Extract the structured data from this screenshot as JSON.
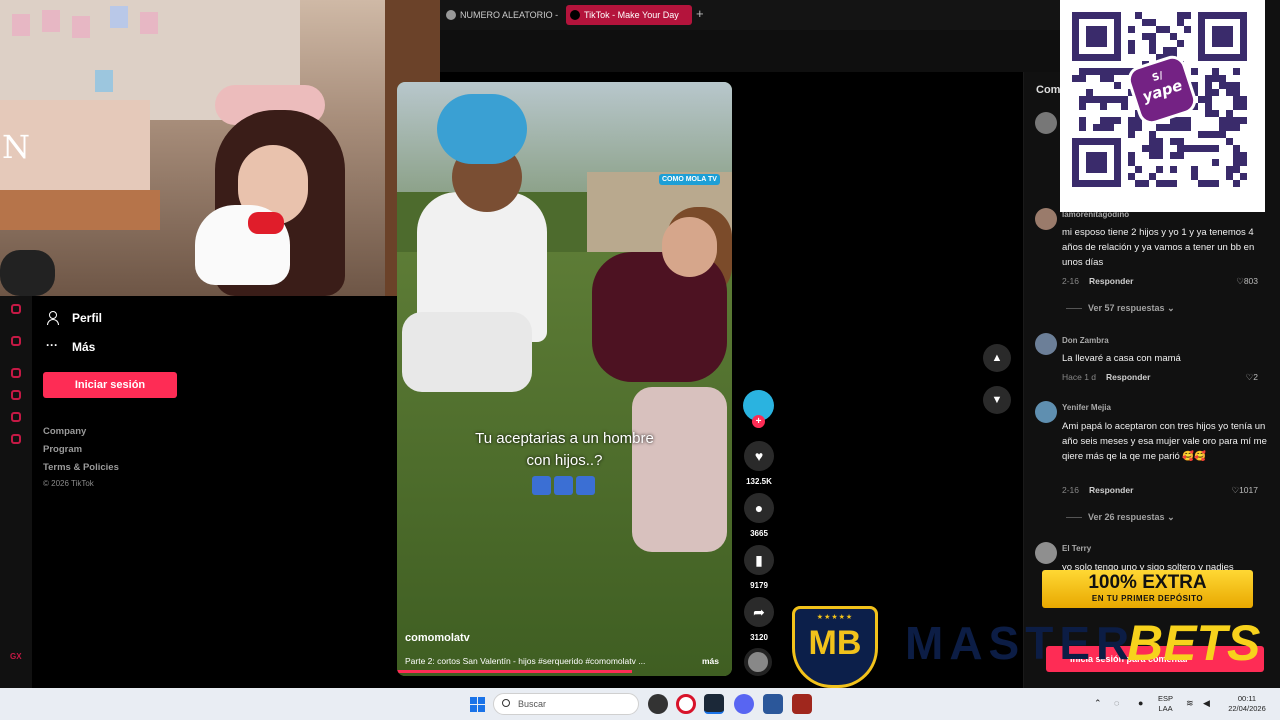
{
  "browser": {
    "tabs": [
      {
        "label": "NUMERO ALEATORIO - Bu",
        "active": false
      },
      {
        "label": "TikTok - Make Your Day",
        "active": true
      }
    ],
    "new_tab": "+"
  },
  "sidebar": {
    "profile_label": "Perfil",
    "more_label": "Más",
    "login_button": "Iniciar sesión",
    "footer_links": [
      "Company",
      "Program",
      "Terms & Policies"
    ],
    "copyright": "© 2026 TikTok",
    "rail_badge": "GX"
  },
  "stream_overlay": {
    "logo_letter": "N"
  },
  "video": {
    "caption_line1": "Tu aceptarias a un hombre",
    "caption_line2": "con hijos..?",
    "watermark": "COMO MOLA TV",
    "author": "comomolatv",
    "description": "Parte 2: cortos San Valentín - hijos #serquerido #comomolatv ...",
    "more_label": "más",
    "progress": 0.7
  },
  "actions": {
    "likes": "132.5K",
    "comments": "3665",
    "saves": "9179",
    "shares": "3120"
  },
  "comments": {
    "title": "Com",
    "items": [
      {
        "user": "lamorenitagodino",
        "text": "mi esposo tiene 2 hijos y yo 1 y ya tenemos 4 años de relación y ya vamos a tener un bb en unos días",
        "date": "2-16",
        "reply": "Responder",
        "likes": "803",
        "view_replies": "Ver 57 respuestas"
      },
      {
        "user": "Don Zambra",
        "text": "La llevaré a casa con mamá",
        "date": "Hace 1 d",
        "reply": "Responder",
        "likes": "2",
        "view_replies": ""
      },
      {
        "user": "Yenifer Mejia",
        "text": "Ami papá lo aceptaron con tres hijos yo tenía un año seis meses y esa mujer vale oro para mí me qiere más qe la qe me parió 🥰🥰",
        "date": "2-16",
        "reply": "Responder",
        "likes": "1017",
        "view_replies": "Ver 26 respuestas"
      },
      {
        "user": "El Terry",
        "text": "yo solo tengo uno y sigo soltero y nadies",
        "date": "",
        "reply": "",
        "likes": "",
        "view_replies": ""
      }
    ],
    "add_comment": "Inicia sesión para comentar"
  },
  "qr_overlay": {
    "currency": "S/",
    "brand": "yape"
  },
  "ad_overlay": {
    "headline": "100% EXTRA",
    "subline": "EN TU PRIMER DEPÓSITO",
    "shield_stars": "★★★★★",
    "shield_letters": "MB",
    "brand_part1": "MASTER",
    "brand_part2": "BETS"
  },
  "taskbar": {
    "search_placeholder": "Buscar",
    "language": "ESP",
    "region": "LAA",
    "time": "00:11",
    "date": "22/04/2026"
  },
  "colors": {
    "accent": "#fe2c55",
    "tab_active": "#b4143c",
    "ad_yellow": "#f7d21c",
    "ad_navy": "#0c1d45",
    "yape_purple": "#742284"
  }
}
